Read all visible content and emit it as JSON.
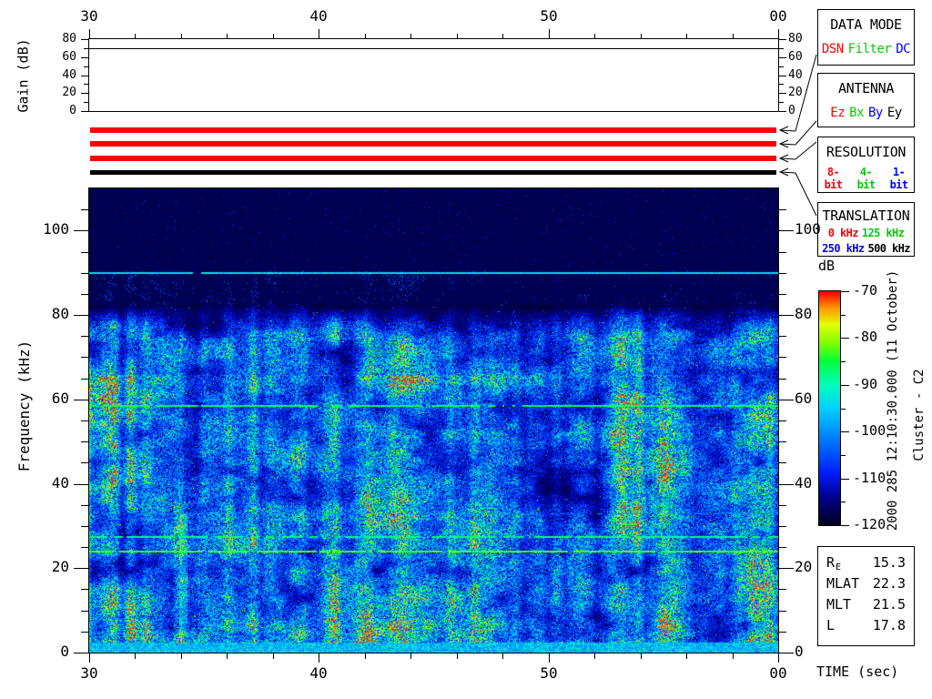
{
  "gain_panel": {
    "ylabel": "Gain (dB)",
    "yticks": [
      "0",
      "20",
      "40",
      "60",
      "80"
    ],
    "ytick_values": [
      0,
      20,
      40,
      60,
      80
    ],
    "gain_value_db": 70
  },
  "time_axis": {
    "tick_labels": [
      "30",
      "40",
      "50",
      "00"
    ],
    "tick_values_sec": [
      30,
      40,
      50,
      60
    ],
    "minor_step_sec": 2
  },
  "spectrogram": {
    "ylabel": "Frequency (kHz)",
    "ytick_values": [
      0,
      20,
      40,
      60,
      80,
      100
    ],
    "freq_range_khz": [
      0,
      110
    ],
    "xlabel": "TIME (sec)"
  },
  "colorbar": {
    "label": "dB",
    "tick_labels": [
      "-70",
      "-80",
      "-90",
      "-100",
      "-110",
      "-120"
    ],
    "tick_values": [
      -70,
      -80,
      -90,
      -100,
      -110,
      -120
    ],
    "range_db": [
      -120,
      -70
    ]
  },
  "info_boxes": [
    {
      "title": "DATA MODE",
      "rows": [
        [
          {
            "label": "DSN",
            "color": "#ff0000"
          },
          {
            "label": "Filter",
            "color": "#00cc00"
          },
          {
            "label": "DC",
            "color": "#0000ff"
          }
        ]
      ]
    },
    {
      "title": "ANTENNA",
      "rows": [
        [
          {
            "label": "Ez",
            "color": "#ff0000"
          },
          {
            "label": "Bx",
            "color": "#00cc00"
          },
          {
            "label": "By",
            "color": "#0000ff"
          },
          {
            "label": "Ey",
            "color": "#000000"
          }
        ]
      ]
    },
    {
      "title": "RESOLUTION",
      "rows": [
        [
          {
            "label": "8-bit",
            "color": "#ff0000"
          },
          {
            "label": "4-bit",
            "color": "#00cc00"
          },
          {
            "label": "1-bit",
            "color": "#0000ff"
          }
        ]
      ]
    },
    {
      "title": "TRANSLATION",
      "rows": [
        [
          {
            "label": "0 kHz",
            "color": "#ff0000"
          },
          {
            "label": "125 kHz",
            "color": "#00cc00"
          }
        ],
        [
          {
            "label": "250 kHz",
            "color": "#0000ff"
          },
          {
            "label": "500 kHz",
            "color": "#000000"
          }
        ]
      ]
    }
  ],
  "mode_bars": [
    {
      "name": "data-mode-bar",
      "color": "#ff0000",
      "links_to": "DATA MODE"
    },
    {
      "name": "antenna-bar",
      "color": "#ff0000",
      "links_to": "ANTENNA"
    },
    {
      "name": "resolution-bar",
      "color": "#ff0000",
      "links_to": "RESOLUTION"
    },
    {
      "name": "translation-bar",
      "color": "#000000",
      "links_to": "TRANSLATION"
    }
  ],
  "side_annotations": {
    "timestamp": "2000 285 12:10:30.000 (11 October)",
    "spacecraft": "Cluster - C2"
  },
  "ephemeris": {
    "rows": [
      {
        "label": "R",
        "sub": "E",
        "value": "15.3"
      },
      {
        "label": "MLAT",
        "sub": "",
        "value": "22.3"
      },
      {
        "label": "MLT",
        "sub": "",
        "value": "21.5"
      },
      {
        "label": "L",
        "sub": "",
        "value": "17.8"
      }
    ]
  },
  "chart_data": {
    "type": "heatmap",
    "x": {
      "label": "TIME (sec)",
      "tick_labels": [
        "30",
        "40",
        "50",
        "00"
      ],
      "tick_values_sec": [
        30,
        40,
        50,
        60
      ],
      "range_sec": [
        30,
        60
      ],
      "minor_step_sec": 2
    },
    "y": {
      "label": "Frequency (kHz)",
      "ticks": [
        0,
        20,
        40,
        60,
        80,
        100
      ],
      "range_khz": [
        0,
        110
      ],
      "minor_step_khz": 5
    },
    "z": {
      "label": "dB",
      "range_db": [
        -120,
        -70
      ],
      "ticks": [
        -70,
        -80,
        -90,
        -100,
        -110,
        -120
      ],
      "colormap": "rainbow: red=-70, yellow=-82, green=-92, cyan=-108, blue=-115, dark navy=-120"
    },
    "gain_series": {
      "label": "Gain (dB)",
      "axis_range_db": [
        0,
        80
      ],
      "value_db": 70,
      "constant_over_interval": true
    },
    "features": {
      "narrowband_lines_khz": [
        {
          "freq_khz": 90,
          "appearance": "cyan line, continuous",
          "approx_db": -105
        },
        {
          "freq_khz": 58.5,
          "appearance": "green line, continuous",
          "approx_db": -95
        },
        {
          "freq_khz": 33,
          "appearance": "faint light-blue line, intermittent",
          "approx_db": -108
        },
        {
          "freq_khz": 27.5,
          "appearance": "green line, intermittent",
          "approx_db": -95
        },
        {
          "freq_khz": 24,
          "appearance": "bright yellow-green line, continuous",
          "approx_db": -92
        }
      ],
      "broadband_hiss": {
        "freq_extent_khz": [
          0,
          82
        ],
        "approx_db_range": [
          -115,
          -100
        ],
        "structure": "turbulent vertical striations of blue/cyan with green patches"
      },
      "strong_burst": {
        "time_sec": 34,
        "freq_extent_khz": [
          3,
          35
        ],
        "approx_db": -85
      },
      "bottom_band": {
        "freq_extent_khz": [
          0,
          2.5
        ],
        "appearance": "bright continuous cyan-blue band"
      },
      "background": {
        "above_khz": 82,
        "approx_db": -120,
        "appearance": "dark navy with sparse speckles"
      }
    }
  }
}
